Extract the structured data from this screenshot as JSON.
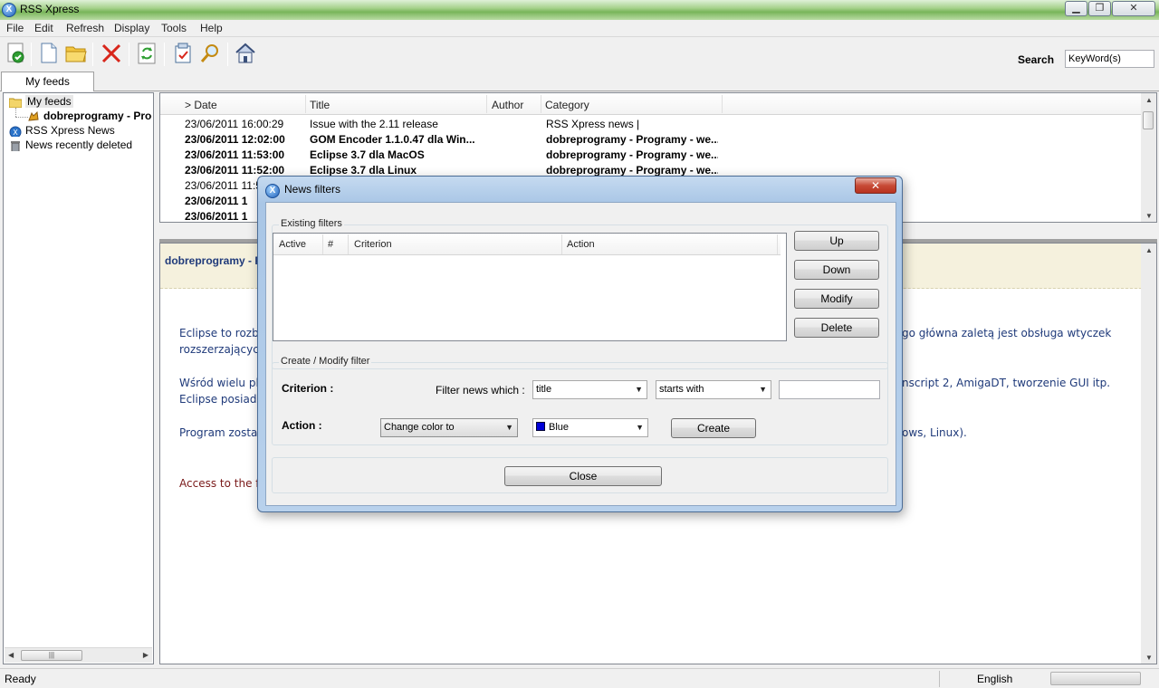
{
  "window": {
    "title": "RSS Xpress"
  },
  "menu": [
    "File",
    "Edit",
    "Refresh",
    "Display",
    "Tools",
    "Help"
  ],
  "toolbar": {
    "icons": [
      "check-feed-icon",
      "new-document-icon",
      "open-folder-icon",
      "delete-icon",
      "refresh-icon",
      "filter-checklist-icon",
      "search-magnifier-icon",
      "home-icon"
    ]
  },
  "search": {
    "label": "Search",
    "placeholder": "KeyWord(s)",
    "value": "KeyWord(s)"
  },
  "tabs": [
    {
      "label": "My feeds"
    }
  ],
  "tree": {
    "items": [
      {
        "label": "My feeds"
      },
      {
        "label": "dobreprogramy - Programy"
      },
      {
        "label": "RSS Xpress News"
      },
      {
        "label": "News recently deleted"
      }
    ]
  },
  "news_list": {
    "columns": [
      "> Date",
      "Title",
      "Author",
      "Category"
    ],
    "rows": [
      {
        "date": "23/06/2011 16:00:29",
        "title": "Issue with the 2.11 release",
        "author": "",
        "category": "RSS Xpress news |",
        "bold": false
      },
      {
        "date": "23/06/2011 12:02:00",
        "title": "GOM Encoder 1.1.0.47 dla Win...",
        "author": "",
        "category": "dobreprogramy - Programy - we...",
        "bold": true
      },
      {
        "date": "23/06/2011 11:53:00",
        "title": "Eclipse 3.7 dla MacOS",
        "author": "",
        "category": "dobreprogramy - Programy - we...",
        "bold": true
      },
      {
        "date": "23/06/2011 11:52:00",
        "title": "Eclipse 3.7 dla Linux",
        "author": "",
        "category": "dobreprogramy - Programy - we...",
        "bold": true
      },
      {
        "date": "23/06/2011 11:5",
        "title": "",
        "author": "",
        "category": "",
        "bold": false
      },
      {
        "date": "23/06/2011 1",
        "title": "",
        "author": "",
        "category": "",
        "bold": true
      },
      {
        "date": "23/06/2011 1",
        "title": "",
        "author": "",
        "category": "",
        "bold": true
      }
    ]
  },
  "preview": {
    "title": "dobreprogramy - P",
    "lines": [
      {
        "left": "Eclipse to rozbi",
        "right": "go główna zaletą jest obsługa wtyczek"
      },
      {
        "left": "rozszerzającyc",
        "right": ""
      },
      {
        "left": "Wśród wielu pl",
        "right": "nscript 2, AmigaDT, tworzenie GUI itp."
      },
      {
        "left": "Eclipse posiada",
        "right": ""
      },
      {
        "left": "Program zosta",
        "right": "ows, Linux)."
      },
      {
        "left": "Access to the f",
        "right": ""
      }
    ]
  },
  "status": {
    "text": "Ready",
    "language": "English"
  },
  "dialog": {
    "title": "News filters",
    "existing_group": "Existing filters",
    "table_columns": [
      "Active",
      "#",
      "Criterion",
      "Action"
    ],
    "buttons": {
      "up": "Up",
      "down": "Down",
      "modify": "Modify",
      "delete": "Delete",
      "create": "Create",
      "close": "Close"
    },
    "create_group": "Create / Modify filter",
    "criterion_label": "Criterion :",
    "filter_news_which": "Filter news which :",
    "field_value": "title",
    "operator_value": "starts with",
    "criterion_text": "",
    "action_label": "Action :",
    "action_value": "Change color to",
    "color_value": "Blue",
    "color_hex": "#0000d8"
  }
}
